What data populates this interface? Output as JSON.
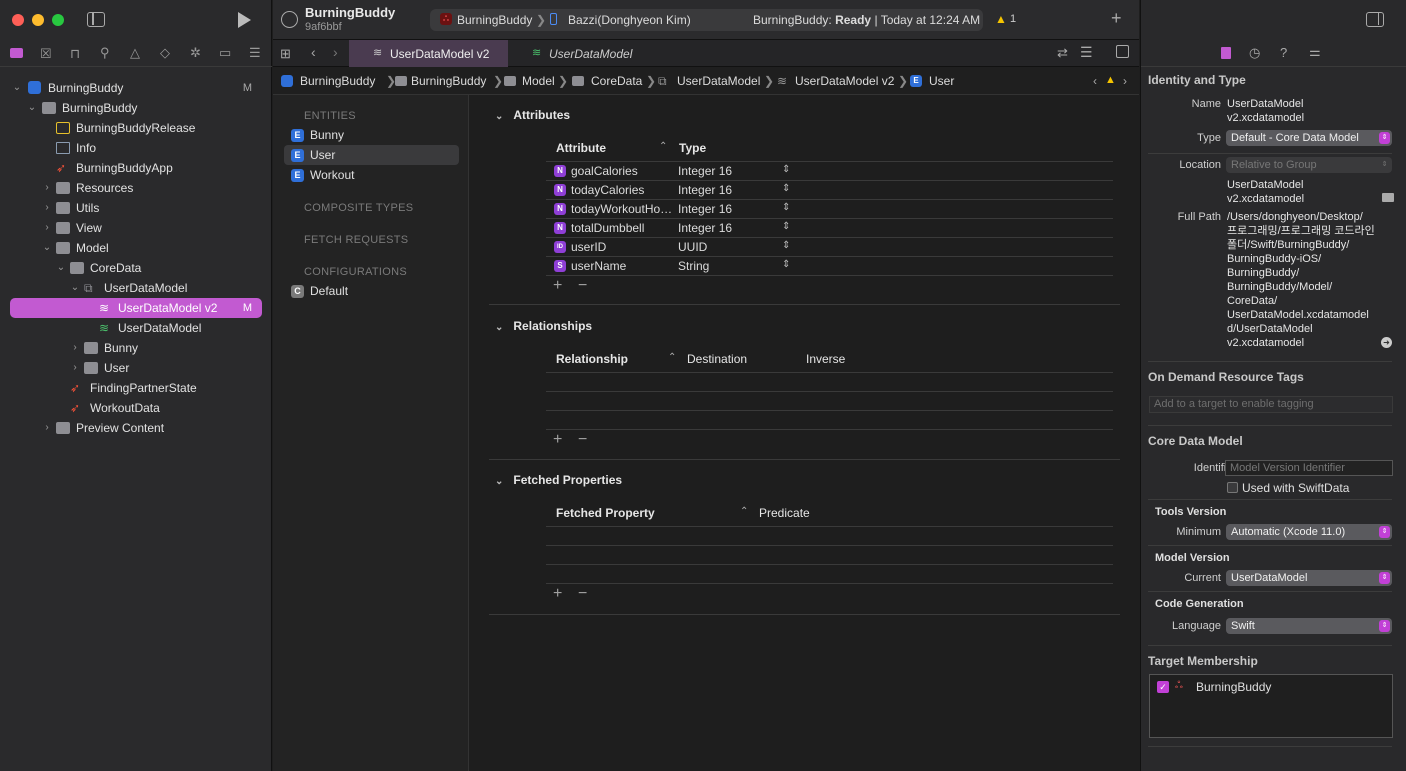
{
  "toolbar": {
    "project_name": "BurningBuddy",
    "commit": "9af6bbf",
    "scheme": "BurningBuddy",
    "device": "Bazzi(Donghyeon Kim)",
    "status_app": "BurningBuddy:",
    "status_state": "Ready",
    "status_time": "| Today at 12:24 AM",
    "warning_count": "1",
    "add_label": "+"
  },
  "tabs": [
    {
      "label": "UserDataModel v2",
      "active": true
    },
    {
      "label": "UserDataModel",
      "active": false
    }
  ],
  "navigator": {
    "items": [
      {
        "label": "BurningBuddy",
        "badge": "M"
      },
      {
        "label": "BurningBuddy"
      },
      {
        "label": "BurningBuddyRelease"
      },
      {
        "label": "Info"
      },
      {
        "label": "BurningBuddyApp"
      },
      {
        "label": "Resources"
      },
      {
        "label": "Utils"
      },
      {
        "label": "View"
      },
      {
        "label": "Model"
      },
      {
        "label": "CoreData"
      },
      {
        "label": "UserDataModel"
      },
      {
        "label": "UserDataModel v2",
        "badge": "M"
      },
      {
        "label": "UserDataModel"
      },
      {
        "label": "Bunny"
      },
      {
        "label": "User"
      },
      {
        "label": "FindingPartnerState"
      },
      {
        "label": "WorkoutData"
      },
      {
        "label": "Preview Content"
      }
    ]
  },
  "breadcrumb": [
    "BurningBuddy",
    "BurningBuddy",
    "Model",
    "CoreData",
    "UserDataModel",
    "UserDataModel v2",
    "User"
  ],
  "entities_panel": {
    "entities_header": "ENTITIES",
    "entities": [
      "Bunny",
      "User",
      "Workout"
    ],
    "composite_header": "COMPOSITE TYPES",
    "fetch_header": "FETCH REQUESTS",
    "config_header": "CONFIGURATIONS",
    "configurations": [
      "Default"
    ]
  },
  "attributes": {
    "title": "Attributes",
    "col_attribute": "Attribute",
    "col_type": "Type",
    "rows": [
      {
        "badge": "N",
        "name": "goalCalories",
        "type": "Integer 16"
      },
      {
        "badge": "N",
        "name": "todayCalories",
        "type": "Integer 16"
      },
      {
        "badge": "N",
        "name": "todayWorkoutHou...",
        "type": "Integer 16"
      },
      {
        "badge": "N",
        "name": "totalDumbbell",
        "type": "Integer 16"
      },
      {
        "badge": "ID",
        "name": "userID",
        "type": "UUID"
      },
      {
        "badge": "S",
        "name": "userName",
        "type": "String"
      }
    ]
  },
  "relationships": {
    "title": "Relationships",
    "col_relationship": "Relationship",
    "col_destination": "Destination",
    "col_inverse": "Inverse"
  },
  "fetched": {
    "title": "Fetched Properties",
    "col_property": "Fetched Property",
    "col_predicate": "Predicate"
  },
  "inspector": {
    "identity_title": "Identity and Type",
    "name_label": "Name",
    "name_value_1": "UserDataModel",
    "name_value_2": "v2.xcdatamodel",
    "type_label": "Type",
    "type_value": "Default - Core Data Model",
    "location_label": "Location",
    "location_value": "Relative to Group",
    "location_file_1": "UserDataModel",
    "location_file_2": "v2.xcdatamodel",
    "fullpath_label": "Full Path",
    "fullpath_lines": [
      "/Users/donghyeon/Desktop/",
      "프로그래밍/프로그래밍 코드라인",
      "폴더/Swift/BurningBuddy/",
      "BurningBuddy-iOS/",
      "BurningBuddy/",
      "BurningBuddy/Model/",
      "CoreData/",
      "UserDataModel.xcdatamodel",
      "d/UserDataModel",
      "v2.xcdatamodel"
    ],
    "odr_title": "On Demand Resource Tags",
    "odr_placeholder": "Add to a target to enable tagging",
    "cdm_title": "Core Data Model",
    "identifier_label": "Identifier",
    "identifier_placeholder": "Model Version Identifier",
    "swiftdata_label": "Used with SwiftData",
    "tools_title": "Tools Version",
    "minimum_label": "Minimum",
    "minimum_value": "Automatic (Xcode 11.0)",
    "mv_title": "Model Version",
    "current_label": "Current",
    "current_value": "UserDataModel",
    "cg_title": "Code Generation",
    "language_label": "Language",
    "language_value": "Swift",
    "tm_title": "Target Membership",
    "tm_target": "BurningBuddy"
  },
  "colors": {
    "accent": "#c25ad1",
    "entity_badge": "#2f6fd8",
    "attr_badge": "#8f3fd6",
    "warning": "#f5c400"
  }
}
